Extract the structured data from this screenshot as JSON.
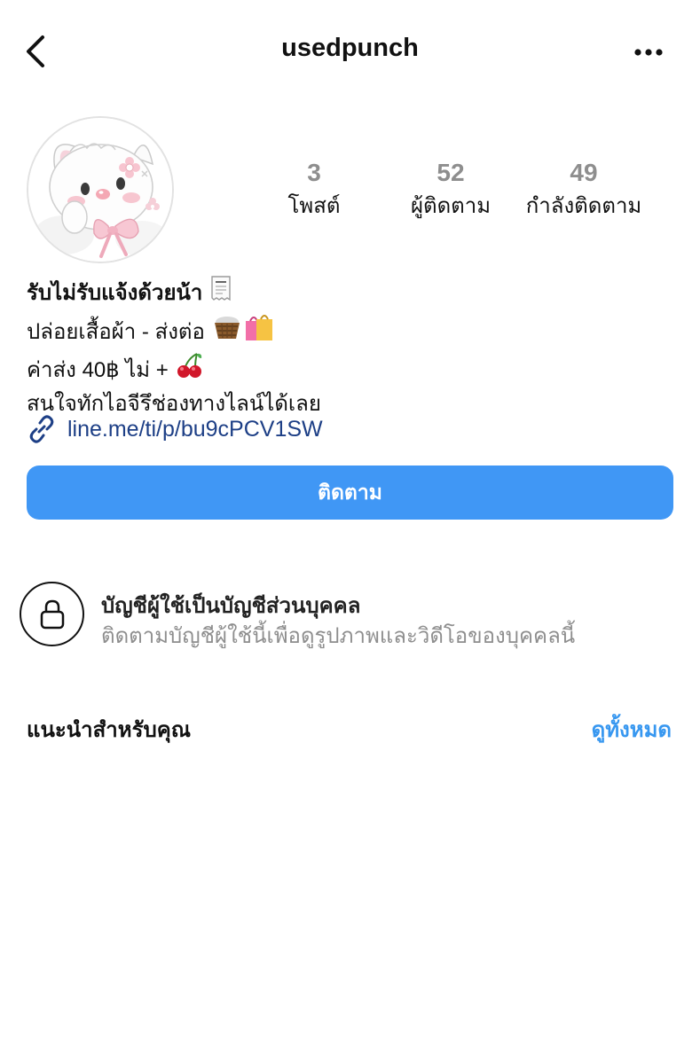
{
  "header": {
    "username": "usedpunch",
    "back_icon": "chevron-left-icon",
    "more_icon": "ellipsis-icon"
  },
  "profile": {
    "avatar_icon": "cute-cat-with-bow-avatar",
    "stats": [
      {
        "value": "3",
        "label": "โพสต์"
      },
      {
        "value": "52",
        "label": "ผู้ติดตาม"
      },
      {
        "value": "49",
        "label": "กำลังติดตาม"
      }
    ]
  },
  "bio": {
    "name": "รับไม่รับแจ้งด้วยน้า",
    "lines": [
      "ปล่อยเสื้อผ้า - ส่งต่อ",
      "ค่าส่ง 40฿ ไม่ +",
      "สนใจทักไอจีรึช่องทางไลน์ได้เลย"
    ],
    "link": "line.me/ti/p/bu9cPCV1SW"
  },
  "follow_button": {
    "label": "ติดตาม",
    "color": "#4097f5"
  },
  "private_notice": {
    "title": "บัญชีผู้ใช้เป็นบัญชีส่วนบุคคล",
    "description": "ติดตามบัญชีผู้ใช้นี้เพื่อดูรูปภาพและวิดีโอของบุคคลนี้"
  },
  "suggested": {
    "title": "แนะนำสำหรับคุณ",
    "see_all": "ดูทั้งหมด"
  },
  "colors": {
    "accent": "#3797f0",
    "link": "#1d3f86",
    "muted": "#8e8e8e"
  }
}
